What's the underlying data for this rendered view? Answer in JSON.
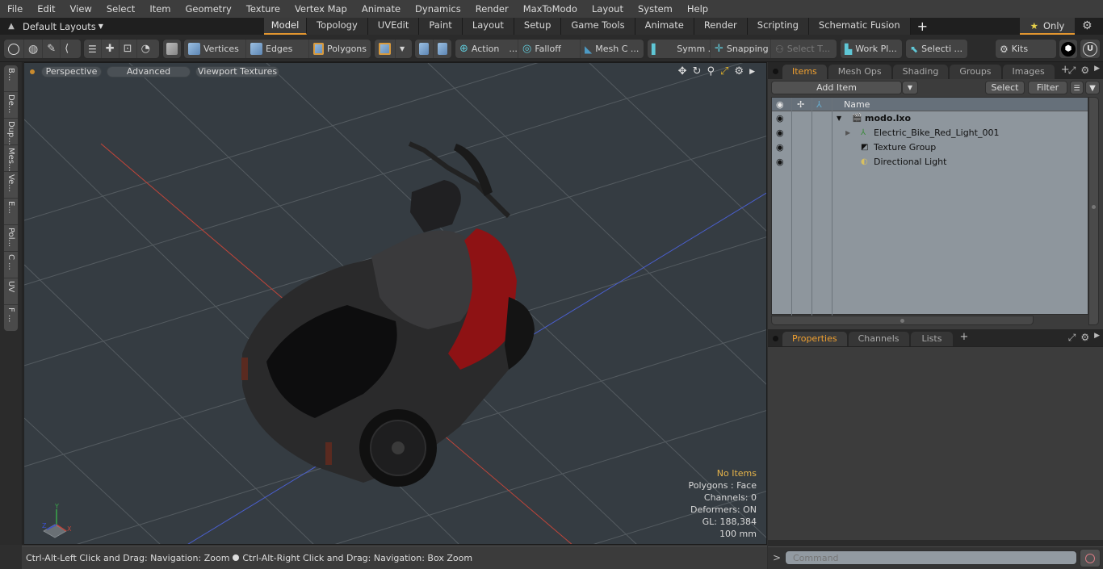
{
  "menu": [
    "File",
    "Edit",
    "View",
    "Select",
    "Item",
    "Geometry",
    "Texture",
    "Vertex Map",
    "Animate",
    "Dynamics",
    "Render",
    "MaxToModo",
    "Layout",
    "System",
    "Help"
  ],
  "layout_bar": {
    "layouts_dropdown": "Default Layouts",
    "tabs": [
      "Model",
      "Topology",
      "UVEdit",
      "Paint",
      "Layout",
      "Setup",
      "Game Tools",
      "Animate",
      "Render",
      "Scripting",
      "Schematic Fusion"
    ],
    "active_tab": "Model",
    "add_tab": "+",
    "only_label": "Only",
    "star": "★"
  },
  "toolbar": {
    "vertices": "Vertices",
    "edges": "Edges",
    "polygons": "Polygons",
    "action": "Action",
    "action_more": "...",
    "falloff": "Falloff",
    "mesh_c": "Mesh C ...",
    "symm": "Symm ...",
    "snapping": "Snapping",
    "select_t": "Select T...",
    "work_pl": "Work Pl...",
    "selecti": "Selecti ...",
    "kits": "Kits"
  },
  "left_tabs": [
    "B...",
    "De...",
    "Dup...",
    "Mes...",
    "Ve...",
    "E...",
    "Pol...",
    "C ...",
    "UV",
    "F ..."
  ],
  "viewport": {
    "buttons": [
      "Perspective",
      "Advanced",
      "Viewport Textures"
    ],
    "stats": {
      "selection": "No Items",
      "polygons": "Polygons : Face",
      "channels": "Channels: 0",
      "deformers": "Deformers: ON",
      "gl": "GL: 188,384",
      "unit": "100 mm"
    },
    "axis_labels": {
      "x": "X",
      "y": "Y",
      "z": "Z"
    },
    "colors": {
      "x_axis": "#c0453a",
      "z_axis": "#4a5fd0",
      "grid": "#5a6166",
      "bg": "#353c42",
      "body_red": "#8e1214"
    }
  },
  "status_bar": {
    "hint_left": "Ctrl-Alt-Left Click and Drag: Navigation: Zoom",
    "hint_right": "Ctrl-Alt-Right Click and Drag: Navigation: Box Zoom"
  },
  "items_panel": {
    "tabs": [
      "Items",
      "Mesh Ops",
      "Shading",
      "Groups",
      "Images"
    ],
    "active_tab": "Items",
    "add_item": "Add Item",
    "select": "Select",
    "filter": "Filter",
    "column_name": "Name",
    "tree": [
      {
        "label": "modo.lxo",
        "icon": "scene-icon",
        "depth": 0,
        "expanded": true,
        "bold": true
      },
      {
        "label": "Electric_Bike_Red_Light_001",
        "icon": "mesh-locator-icon",
        "depth": 1,
        "expanded": false
      },
      {
        "label": "Texture Group",
        "icon": "texture-group-icon",
        "depth": 1
      },
      {
        "label": "Directional Light",
        "icon": "light-icon",
        "depth": 1
      }
    ]
  },
  "properties_panel": {
    "tabs": [
      "Properties",
      "Channels",
      "Lists"
    ],
    "active_tab": "Properties"
  },
  "command": {
    "prompt": ">",
    "placeholder": "Command"
  },
  "accent_color": "#e3962f"
}
